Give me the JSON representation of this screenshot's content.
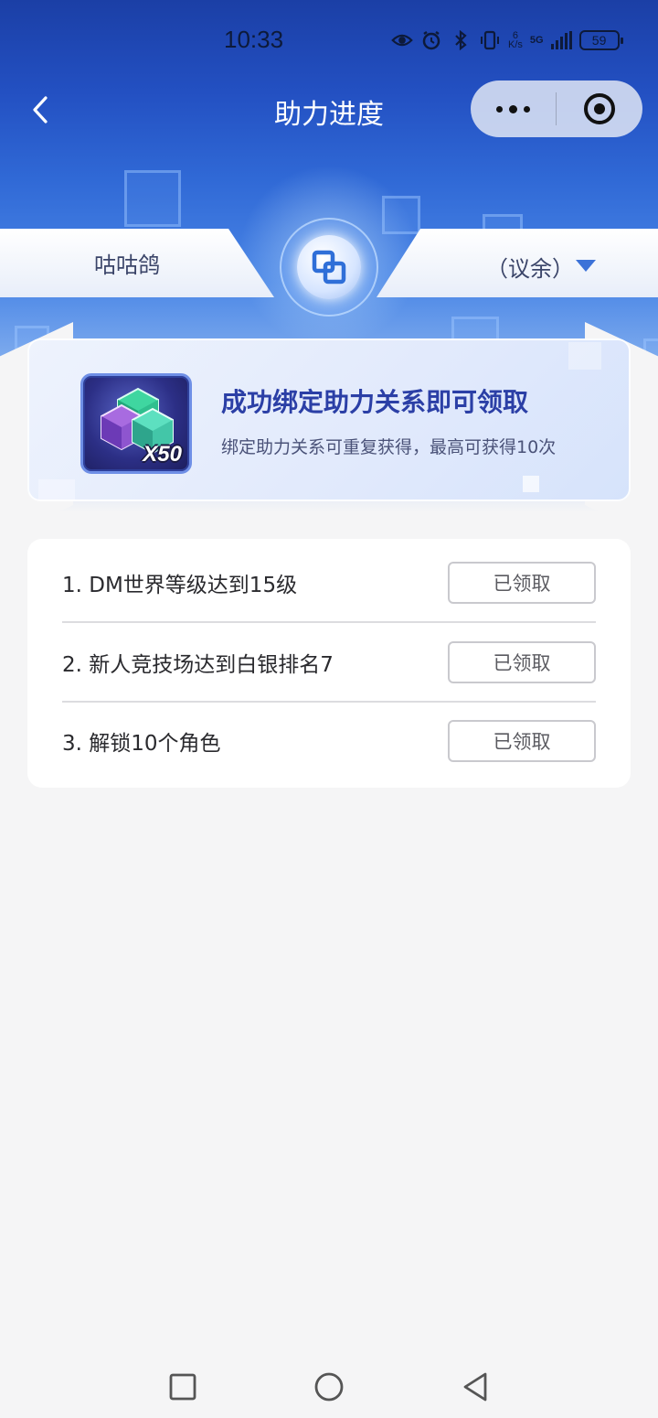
{
  "status_bar": {
    "time": "10:33",
    "speed_value": "6",
    "speed_unit": "K/s",
    "network": "5G",
    "battery": "59"
  },
  "nav": {
    "title": "助力进度"
  },
  "binding": {
    "left_name": "咕咕鸽",
    "right_name": "（议余）"
  },
  "reward": {
    "quantity": "X50",
    "title": "成功绑定助力关系即可领取",
    "subtitle": "绑定助力关系可重复获得，最高可获得10次"
  },
  "tasks": [
    {
      "text": "1. DM世界等级达到15级",
      "button": "已领取"
    },
    {
      "text": "2. 新人竞技场达到白银排名7",
      "button": "已领取"
    },
    {
      "text": "3. 解锁10个角色",
      "button": "已领取"
    }
  ],
  "colors": {
    "header_blue": "#2350c2",
    "accent": "#3c72d8",
    "reward_title": "#2b3fa6"
  }
}
